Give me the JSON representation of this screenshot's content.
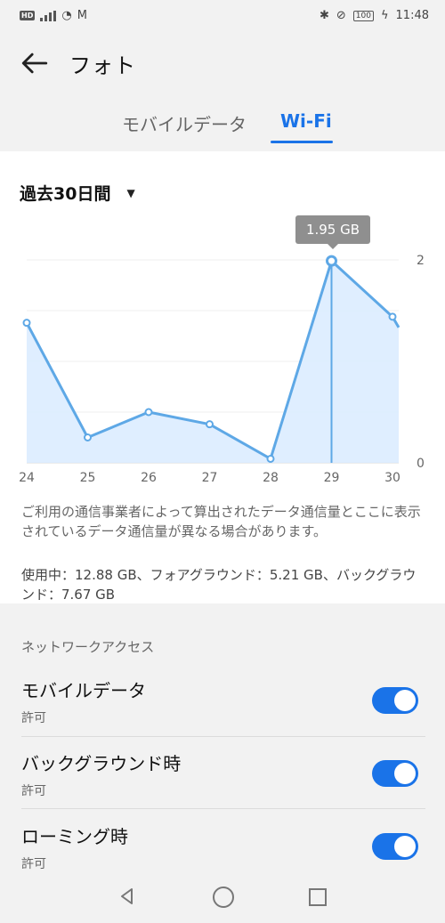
{
  "status_bar": {
    "hd": "HD",
    "battery": "100",
    "time": "11:48"
  },
  "app_bar": {
    "title": "フォト"
  },
  "tabs": [
    {
      "label": "モバイルデータ",
      "selected": false
    },
    {
      "label": "Wi-Fi",
      "selected": true
    }
  ],
  "period": {
    "label": "過去30日間"
  },
  "tooltip": {
    "value": "1.95 GB"
  },
  "chart_data": {
    "type": "area",
    "x": [
      24,
      25,
      26,
      27,
      28,
      29,
      30
    ],
    "series": [
      {
        "values": [
          1.38,
          0.25,
          0.5,
          0.38,
          0.04,
          1.99,
          1.44
        ]
      }
    ],
    "ylim": [
      0,
      2
    ],
    "y_tick_labels": [
      "2",
      "0"
    ],
    "x_tick_labels": [
      "24",
      "25",
      "26",
      "27",
      "28",
      "29",
      "30"
    ],
    "highlight_index": 5
  },
  "notes": {
    "carrier": "ご利用の通信事業者によって算出されたデータ通信量とここに表示されているデータ通信量が異なる場合があります。",
    "usage": "使用中：12.88 GB、フォアグラウンド：5.21 GB、バックグラウンド：7.67 GB"
  },
  "network_access": {
    "section_title": "ネットワークアクセス",
    "items": [
      {
        "label": "モバイルデータ",
        "status": "許可",
        "enabled": true
      },
      {
        "label": "バックグラウンド時",
        "status": "許可",
        "enabled": true
      },
      {
        "label": "ローミング時",
        "status": "許可",
        "enabled": true
      }
    ]
  },
  "colors": {
    "accent": "#1a73e8",
    "line": "#5ea8e6",
    "area": "#dcecff"
  },
  "icons": {
    "back": "arrow-left-icon",
    "dropdown": "triangle-down-icon",
    "nav_back": "nav-back-icon",
    "nav_home": "nav-home-icon",
    "nav_recent": "nav-recent-icon"
  }
}
